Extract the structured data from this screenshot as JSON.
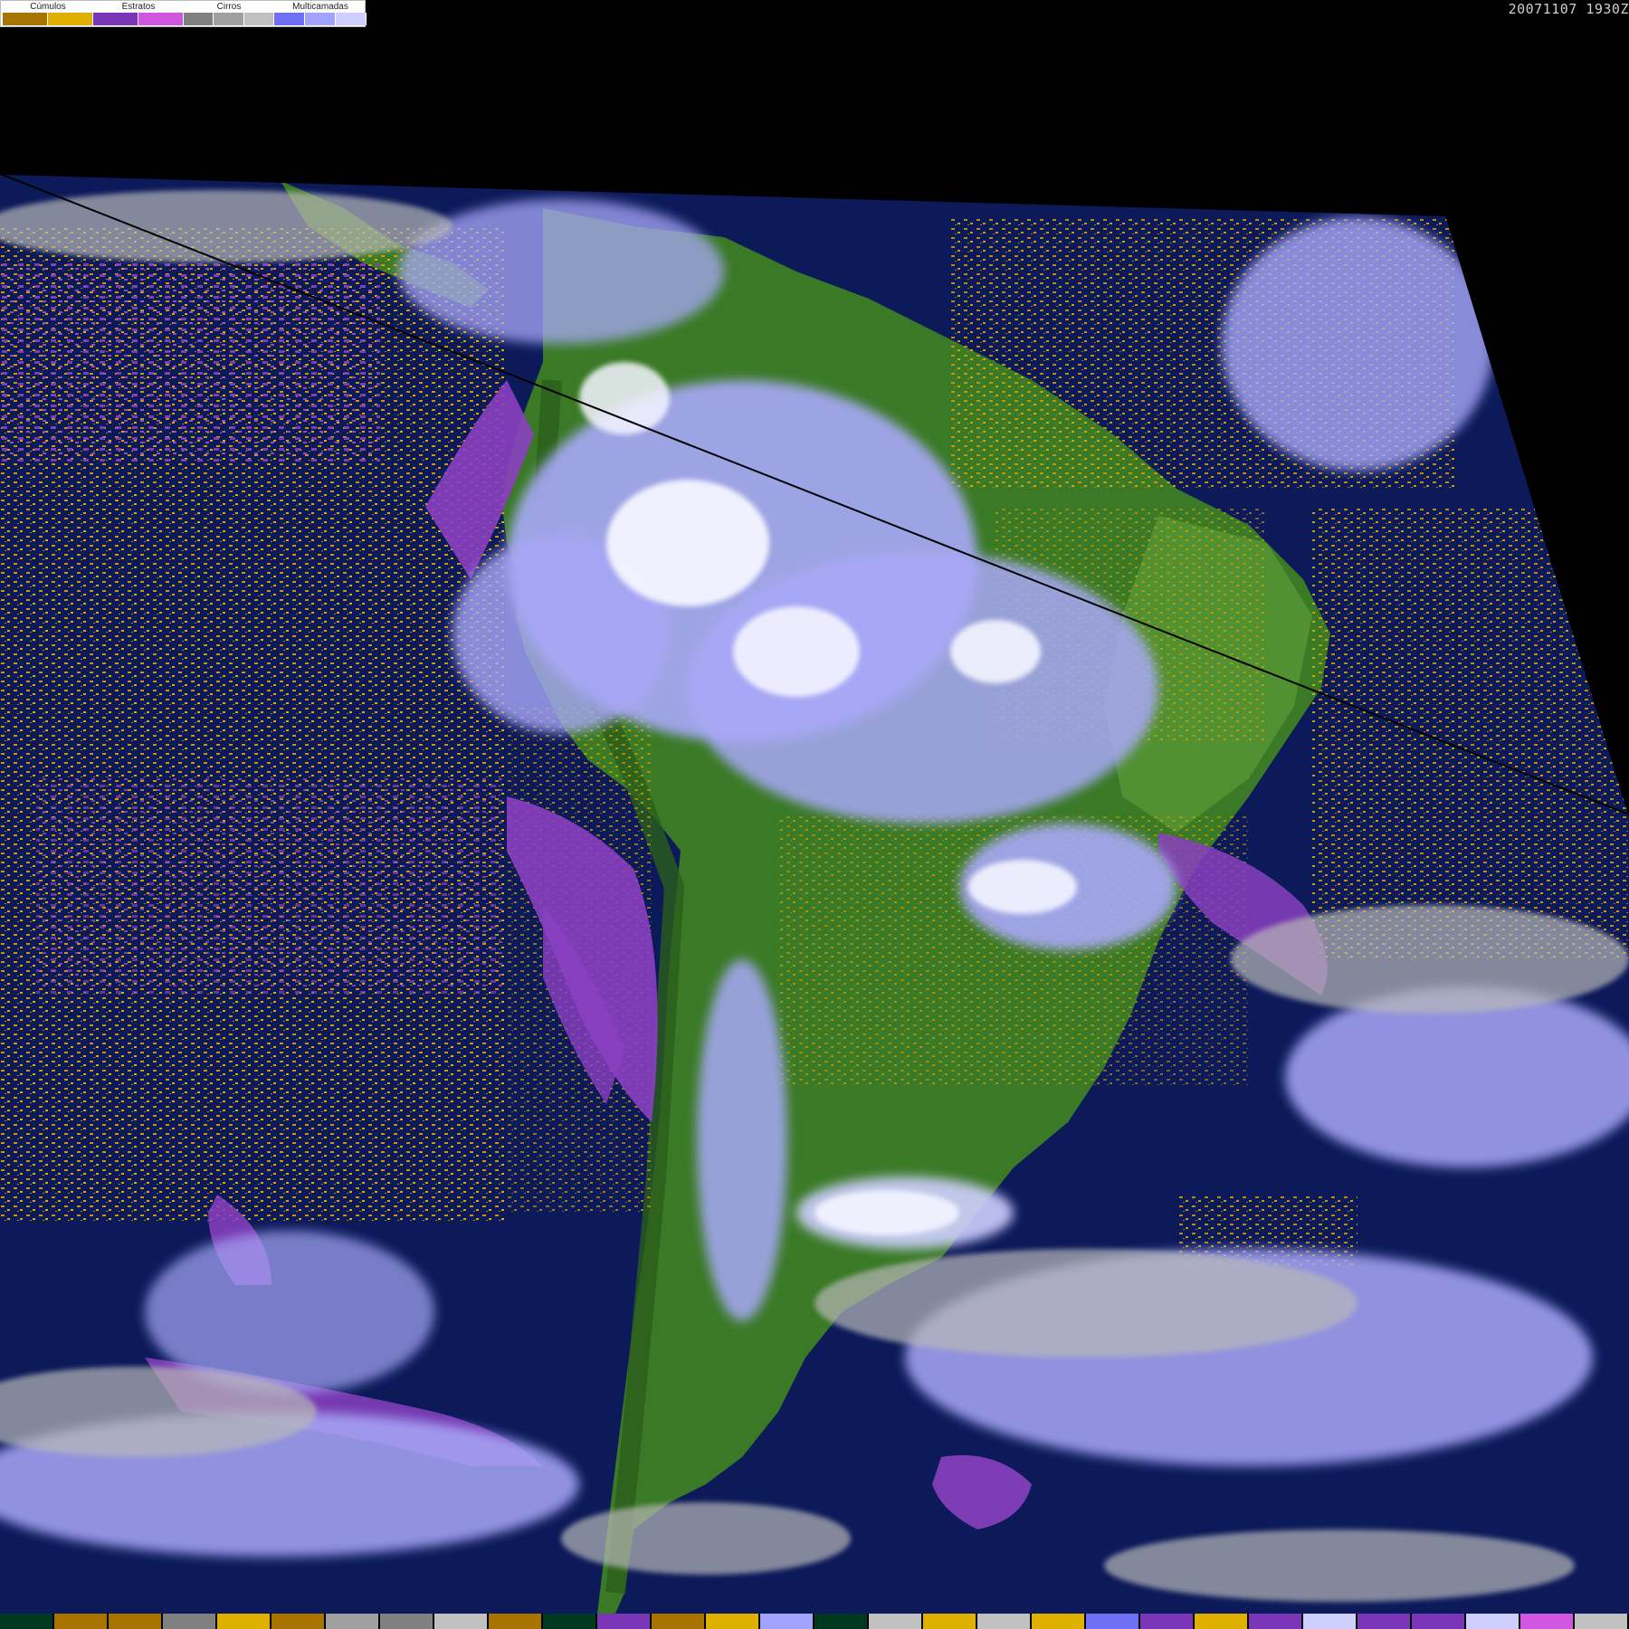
{
  "timestamp": "20071107 1930Z",
  "legend": {
    "groups": [
      {
        "label": "Cúmulos",
        "swatches": [
          "#a87400",
          "#e0b000"
        ]
      },
      {
        "label": "Estratos",
        "swatches": [
          "#7a36b6",
          "#d056e0"
        ]
      },
      {
        "label": "Cirros",
        "swatches": [
          "#808080",
          "#a0a0a0",
          "#c0c0c0"
        ]
      },
      {
        "label": "Multicamadas",
        "swatches": [
          "#6f6ff5",
          "#a2a2ff",
          "#cfcfff"
        ]
      }
    ]
  },
  "colors": {
    "background": "#000000",
    "ocean": "#0c1a5a",
    "land": "#3a7a26",
    "land_light": "#5a9a36",
    "cumulus": "#d8a000",
    "stratus": "#8a40c0",
    "cirrus": "#b8b8b8",
    "multilayer": "#a8a8f8",
    "white_cloud": "#f4f4ff"
  },
  "bottom_strip": [
    "#003820",
    "#a87400",
    "#a87400",
    "#808080",
    "#e0b000",
    "#a87400",
    "#a0a0a0",
    "#808080",
    "#c0c0c0",
    "#a87400",
    "#003820",
    "#7a36b6",
    "#a87400",
    "#e0b000",
    "#a2a2ff",
    "#003820",
    "#c0c0c0",
    "#e0b000",
    "#c0c0c0",
    "#e0b000",
    "#6f6ff5",
    "#7a36b6",
    "#e0b000",
    "#7a36b6",
    "#cfcfff",
    "#7a36b6",
    "#7a36b6",
    "#cfcfff",
    "#d056e0",
    "#c0c0c0"
  ]
}
